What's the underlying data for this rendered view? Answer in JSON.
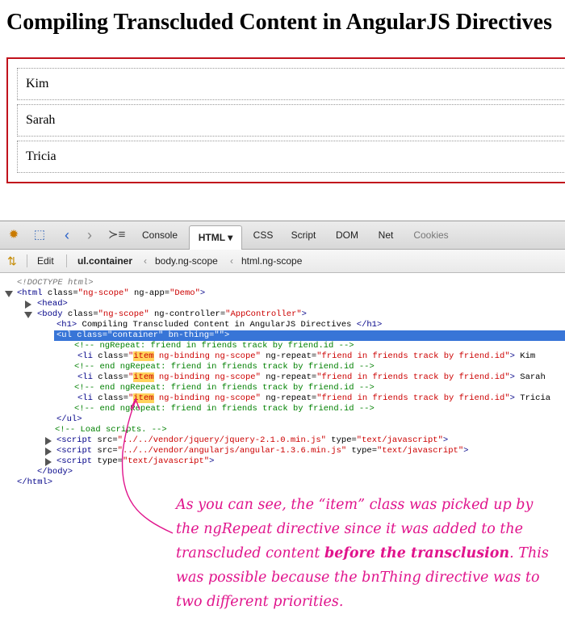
{
  "page": {
    "title": "Compiling Transcluded Content in AngularJS Directives",
    "items": [
      "Kim",
      "Sarah",
      "Tricia"
    ]
  },
  "devtools": {
    "tabs": [
      {
        "label": "Console"
      },
      {
        "label": "HTML ▾"
      },
      {
        "label": "CSS"
      },
      {
        "label": "Script"
      },
      {
        "label": "DOM"
      },
      {
        "label": "Net"
      },
      {
        "label": "Cookies"
      }
    ],
    "active_tab": "HTML",
    "edit_label": "Edit",
    "breadcrumbs": [
      "ul.container",
      "body.ng-scope",
      "html.ng-scope"
    ],
    "colors": {
      "selected_row": "#3875d7",
      "highlight": "#ffd35c"
    }
  },
  "tree": [
    {
      "dt": "<!DOCTYPE html>"
    },
    {
      "t1": "<html ",
      "a1": "class=",
      "v1": "\"ng-scope\"",
      "a2": " ng-app=",
      "v2": "\"Demo\"",
      "t2": ">"
    },
    {
      "t1": "<head>"
    },
    {
      "t1": "<body ",
      "a1": "class=",
      "v1": "\"ng-scope\"",
      "a2": " ng-controller=",
      "v2": "\"AppController\"",
      "t2": ">"
    },
    {
      "t1": "<h1>",
      "x": " Compiling Transcluded Content in AngularJS Directives ",
      "t2": "</h1>"
    },
    {
      "t1": "<ul ",
      "a1": "class=",
      "v1": "\"container\"",
      "a2": " bn-thing=",
      "v2": "\"\"",
      "t2": ">"
    },
    {
      "c": "<!-- ngRepeat: friend in friends track by friend.id -->"
    },
    {
      "t1": "<li ",
      "a1": "class=",
      "q": "\"",
      "h": "item",
      "v1": " ng-binding ng-scope\"",
      "a2": " ng-repeat=",
      "v2": "\"friend in friends track by friend.id\"",
      "t2": ">",
      "x": " Kim"
    },
    {
      "c": "<!-- end ngRepeat: friend in friends track by friend.id -->"
    },
    {
      "t1": "<li ",
      "a1": "class=",
      "q": "\"",
      "h": "item",
      "v1": " ng-binding ng-scope\"",
      "a2": " ng-repeat=",
      "v2": "\"friend in friends track by friend.id\"",
      "t2": ">",
      "x": " Sarah"
    },
    {
      "c": "<!-- end ngRepeat: friend in friends track by friend.id -->"
    },
    {
      "t1": "<li ",
      "a1": "class=",
      "q": "\"",
      "h": "item",
      "v1": " ng-binding ng-scope\"",
      "a2": " ng-repeat=",
      "v2": "\"friend in friends track by friend.id\"",
      "t2": ">",
      "x": " Tricia"
    },
    {
      "c": "<!-- end ngRepeat: friend in friends track by friend.id -->"
    },
    {
      "t1": "</ul>"
    },
    {
      "c": "<!-- Load scripts. -->"
    },
    {
      "t1": "<script ",
      "a1": "src=",
      "v1": "\"../../vendor/jquery/jquery-2.1.0.min.js\"",
      "a2": " type=",
      "v2": "\"text/javascript\"",
      "t2": ">"
    },
    {
      "t1": "<script ",
      "a1": "src=",
      "v1": "\"../../vendor/angularjs/angular-1.3.6.min.js\"",
      "a2": " type=",
      "v2": "\"text/javascript\"",
      "t2": ">"
    },
    {
      "t1": "<script ",
      "a1": "type=",
      "v1": "\"text/javascript\"",
      "t2": ">"
    },
    {
      "t1": "</body>"
    },
    {
      "t1": "</html>"
    }
  ],
  "annotation": {
    "part1": "As you can see, the “item” class was picked up by the ngRepeat directive since it was added to the transcluded content ",
    "bold": "before the transclusion",
    "part2": ". This was possible because the bnThing directive was to two different priorities."
  }
}
